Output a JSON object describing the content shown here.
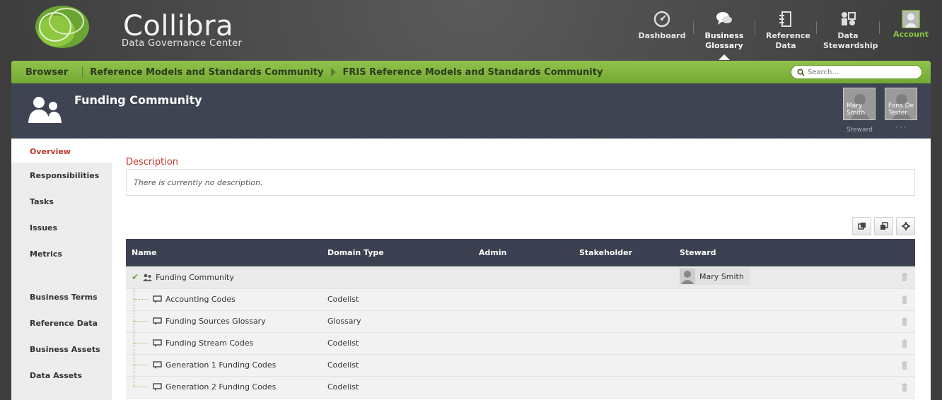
{
  "brand": {
    "name": "Collibra",
    "subtitle": "Data Governance Center"
  },
  "nav": [
    {
      "label": "Dashboard",
      "icon": "dashboard-gauge-icon"
    },
    {
      "label": "Business Glossary",
      "icon": "speech-bubbles-icon",
      "active": true
    },
    {
      "label": "Reference Data",
      "icon": "reference-data-icon"
    },
    {
      "label": "Data Stewardship",
      "icon": "stewardship-icon"
    },
    {
      "label": "Account",
      "icon": "user-silhouette-icon"
    }
  ],
  "breadcrumb": {
    "root": "Browser",
    "items": [
      "Reference Models and Standards Community",
      "FRIS Reference Models and Standards Community"
    ]
  },
  "search": {
    "placeholder": "Search..."
  },
  "page": {
    "title": "Funding Community"
  },
  "stewards": [
    {
      "name": "Mary Smith",
      "role": "Steward"
    },
    {
      "name": "Fons De Tester",
      "role": "- - -"
    }
  ],
  "sidebar": {
    "items": [
      "Overview",
      "Responsibilities",
      "Tasks",
      "Issues",
      "Metrics"
    ],
    "items2": [
      "Business Terms",
      "Reference Data",
      "Business Assets",
      "Data Assets"
    ]
  },
  "description": {
    "title": "Description",
    "text": "There is currently no description."
  },
  "table": {
    "columns": [
      "Name",
      "Domain Type",
      "Admin",
      "Stakeholder",
      "Steward"
    ],
    "group": {
      "name": "Funding Community",
      "steward": "Mary Smith"
    },
    "rows": [
      {
        "name": "Accounting Codes",
        "type": "Codelist"
      },
      {
        "name": "Funding Sources Glossary",
        "type": "Glossary"
      },
      {
        "name": "Funding Stream Codes",
        "type": "Codelist"
      },
      {
        "name": "Generation 1 Funding Codes",
        "type": "Codelist"
      },
      {
        "name": "Generation 2 Funding Codes",
        "type": "Codelist"
      }
    ]
  },
  "colors": {
    "green": "#8fc34a",
    "dark": "#3b4150",
    "accent_red": "#c0392b"
  }
}
